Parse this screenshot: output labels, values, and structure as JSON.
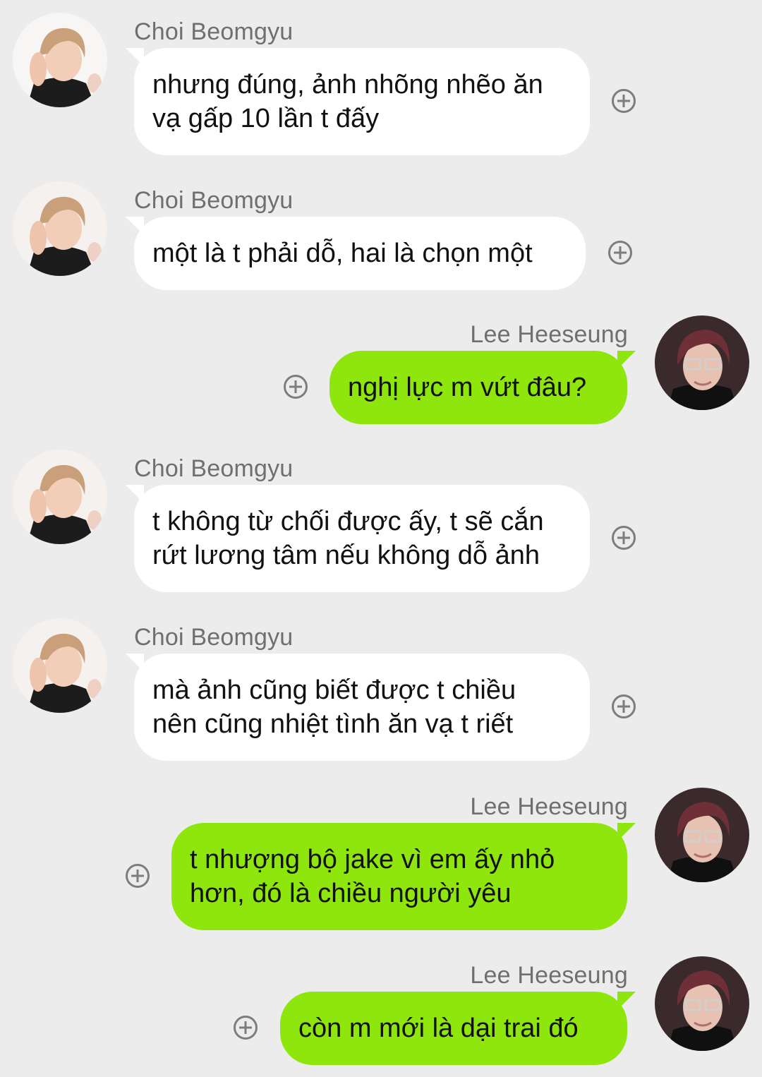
{
  "chat": {
    "messages": [
      {
        "sender": "Choi Beomgyu",
        "line1": "nhưng đúng, ảnh nhõng nhẽo ăn",
        "line2": "vạ gấp 10 lần t đấy"
      },
      {
        "sender": "Choi Beomgyu",
        "line1": "một là t phải dỗ, hai là chọn một"
      },
      {
        "sender": "Lee Heeseung",
        "line1": "nghị lực m vứt đâu?"
      },
      {
        "sender": "Choi Beomgyu",
        "line1": "t không từ chối được ấy, t sẽ cắn",
        "line2": "rứt lương tâm nếu không dỗ ảnh"
      },
      {
        "sender": "Choi Beomgyu",
        "line1": "mà ảnh cũng biết được t chiều",
        "line2": "nên cũng nhiệt tình ăn vạ t riết"
      },
      {
        "sender": "Lee Heeseung",
        "line1": "t nhượng bộ jake vì em ấy nhỏ",
        "line2": "hơn, đó là chiều người yêu"
      },
      {
        "sender": "Lee Heeseung",
        "line1": "còn m mới là dại trai đó"
      }
    ]
  },
  "colors": {
    "background": "#ececec",
    "incoming_bubble": "#ffffff",
    "outgoing_bubble": "#8ee60c",
    "sender_name": "#6f6f6f",
    "message_text": "#111111"
  },
  "icons": {
    "add_reaction": "add-reaction-icon"
  }
}
